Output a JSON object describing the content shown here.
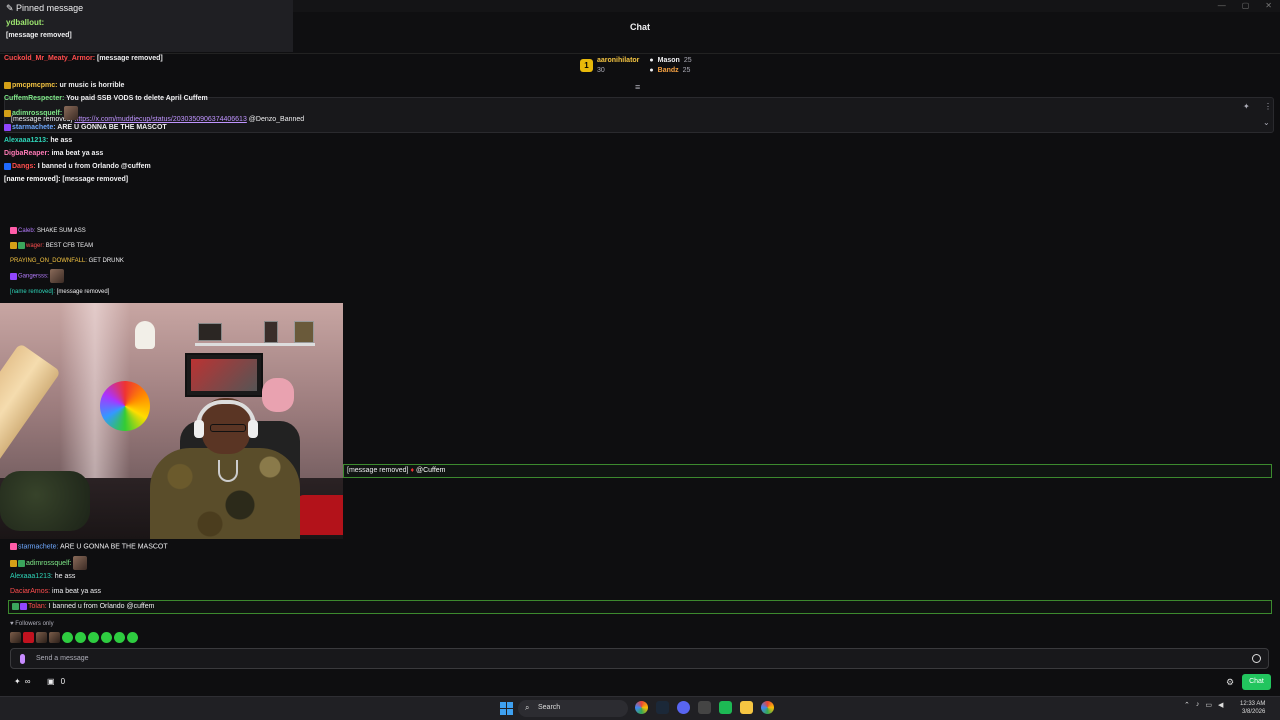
{
  "window": {
    "minimize": "—",
    "maximize": "▢",
    "close": "✕"
  },
  "header": {
    "title": "Chat"
  },
  "leaderboard": {
    "first": {
      "rank": "1",
      "name": "aaronihilator",
      "count": "30"
    },
    "second": {
      "name": "Mason",
      "count": "25"
    },
    "third": {
      "name": "Bandz",
      "count": "25"
    }
  },
  "pinned": {
    "text": "[message removed]",
    "link": "https://x.com/muddiecup/status/2030350906374406613",
    "mention": "@Denzo_Banned"
  },
  "overlay": {
    "title": "Pinned message",
    "pin_user": "ydballout:",
    "pin_text": "[message removed]",
    "lines": [
      {
        "user": "Cuckold_Mr_Meaty_Armor:",
        "text": "[message removed]"
      },
      {
        "user": "pmcpmcpmc:",
        "text": "ur music is horrible"
      },
      {
        "user": "CuffemRespecter:",
        "text": "You paid SSB VODS to delete April Cuffem"
      },
      {
        "user": "adimrossquelf:",
        "text": ""
      },
      {
        "user": "starmachete:",
        "text": "ARE U GONNA BE THE MASCOT"
      },
      {
        "user": "Alexaaa1213:",
        "text": "he ass"
      },
      {
        "user": "DigbaReaper:",
        "text": "ima beat ya ass"
      },
      {
        "user": "Dangs:",
        "text": "I banned u from Orlando @cuffem"
      },
      {
        "user": "[name removed]:",
        "text": "[message removed]"
      }
    ]
  },
  "small_chat": [
    {
      "user": "Caleb:",
      "text": "SHAKE SUM ASS"
    },
    {
      "user": "wager:",
      "text": "BEST CFB TEAM"
    },
    {
      "user": "PRAYING_ON_DOWNFALL:",
      "text": "GET DRUNK"
    },
    {
      "user": "Gangersss:",
      "text": ""
    },
    {
      "user": "[name removed]:",
      "text": "[message removed]"
    }
  ],
  "highlight": {
    "text": "[message removed]",
    "mention": "@Cuffem"
  },
  "lower_chat": [
    {
      "user": "starmachete:",
      "text": "ARE U GONNA BE THE MASCOT"
    },
    {
      "user": "adimrossquelf:",
      "text": ""
    },
    {
      "user": "Alexaaa1213:",
      "text": "he ass"
    },
    {
      "user": "DaciarAmos:",
      "text": "ima beat ya ass"
    }
  ],
  "lower_highlight": {
    "user": "Tolan:",
    "text": "I banned u from Orlando @cuffem"
  },
  "followers_only": "Followers only",
  "input": {
    "placeholder": "Send a message"
  },
  "bottom": {
    "points": "∞",
    "tickets": "0",
    "chat_button": "Chat"
  },
  "taskbar": {
    "search": "Search",
    "time": "12:33 AM",
    "date": "3/8/2026"
  },
  "colors": {
    "accent": "#22c55e",
    "gold": "#e8b90a",
    "link": "#bf94ff"
  }
}
